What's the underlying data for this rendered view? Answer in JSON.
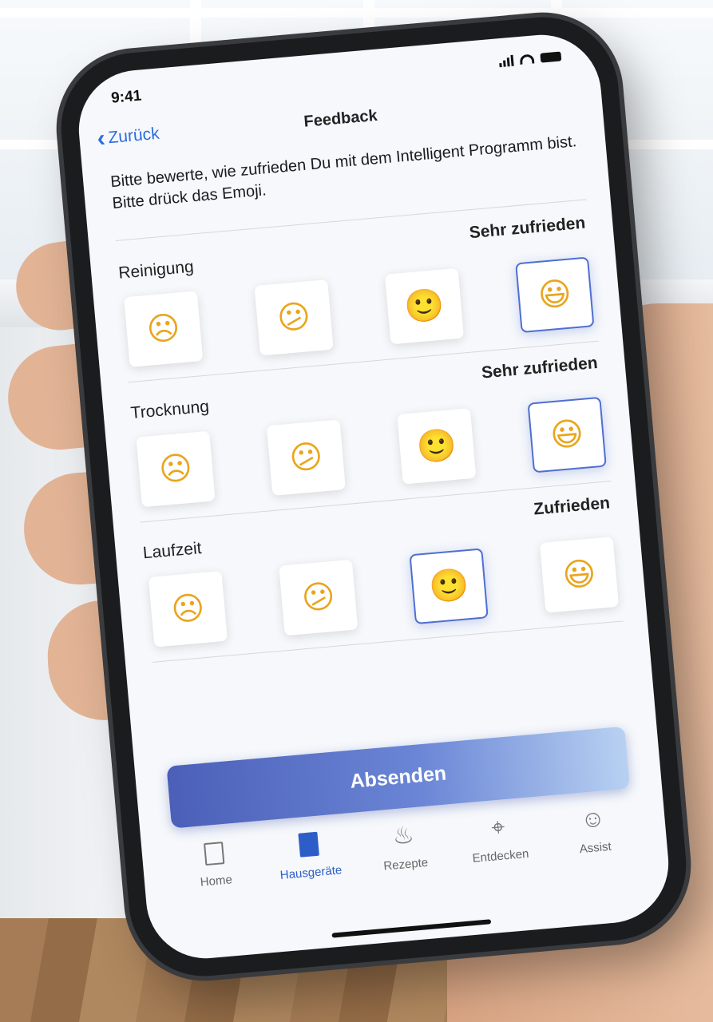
{
  "status": {
    "time": "9:41"
  },
  "nav": {
    "back_label": "Zurück",
    "title": "Feedback"
  },
  "intro": "Bitte bewerte, wie zufrieden Du mit dem Intelligent Programm bist. Bitte drück das Emoji.",
  "sections": [
    {
      "label": "Reinigung",
      "value": "Sehr zufrieden",
      "selected_index": 3
    },
    {
      "label": "Trocknung",
      "value": "Sehr zufrieden",
      "selected_index": 3
    },
    {
      "label": "Laufzeit",
      "value": "Zufrieden",
      "selected_index": 2
    }
  ],
  "emoji_scale": [
    "☹",
    "😕",
    "🙂",
    "😃"
  ],
  "emoji_names": [
    "frowning-face",
    "confused-face",
    "slightly-smiling-face",
    "grinning-face"
  ],
  "submit_label": "Absenden",
  "tabs": [
    {
      "label": "Home",
      "icon": "home-icon",
      "active": false
    },
    {
      "label": "Hausgeräte",
      "icon": "appliance-icon",
      "active": true
    },
    {
      "label": "Rezepte",
      "icon": "chef-hat-icon",
      "active": false
    },
    {
      "label": "Entdecken",
      "icon": "compass-icon",
      "active": false
    },
    {
      "label": "Assist",
      "icon": "chat-smile-icon",
      "active": false
    }
  ],
  "colors": {
    "accent": "#2d5ec8",
    "selected_border": "#4f6fd1",
    "back_link": "#2d6cdf"
  }
}
